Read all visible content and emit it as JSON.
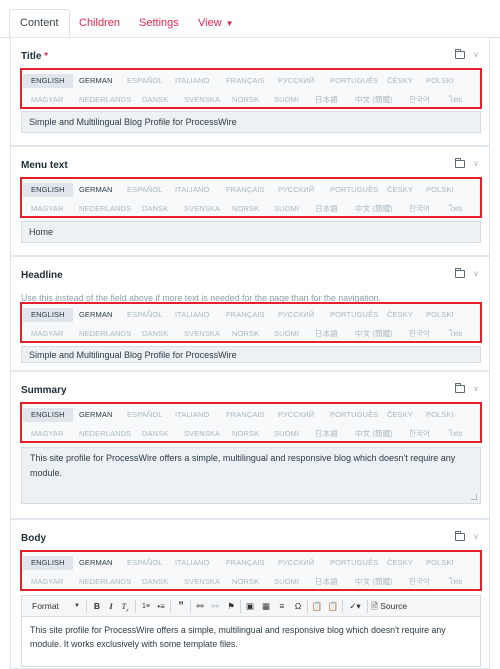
{
  "tabs": [
    {
      "label": "Content"
    },
    {
      "label": "Children"
    },
    {
      "label": "Settings"
    },
    {
      "label": "View"
    }
  ],
  "languages": {
    "row1": [
      "ENGLISH",
      "GERMAN",
      "ESPAÑOL",
      "ITALIANO",
      "FRANÇAIS",
      "РУССКИЙ",
      "PORTUGUÊS",
      "ČESKY",
      "POLSKI"
    ],
    "row2": [
      "MAGYAR",
      "NEDERLANDS",
      "DANSK",
      "SVENSKA",
      "NORSK",
      "SUOMI",
      "日本語",
      "中文 (簡體)",
      "한국어",
      "ไทย"
    ],
    "selected": "ENGLISH"
  },
  "fields": {
    "title": {
      "label": "Title",
      "required_mark": "*",
      "value": "Simple and Multilingual Blog Profile for ProcessWire"
    },
    "menu_text": {
      "label": "Menu text",
      "value": "Home"
    },
    "headline": {
      "label": "Headline",
      "description": "Use this instead of the field above if more text is needed for the page than for the navigation.",
      "value": "Simple and Multilingual Blog Profile for ProcessWire"
    },
    "summary": {
      "label": "Summary",
      "value": "This site profile for ProcessWire offers a simple, multilingual and responsive blog which doesn't require any module."
    },
    "body": {
      "label": "Body",
      "toolbar": {
        "format_label": "Format",
        "source_label": "Source"
      },
      "value": "This site profile for ProcessWire offers a simple, multilingual and responsive blog which doesn't require any module. It works exclusively with some template files."
    }
  },
  "colors": {
    "accent": "#e4284e",
    "highlight_border": "#e5202a",
    "input_bg": "#eef1f4"
  }
}
